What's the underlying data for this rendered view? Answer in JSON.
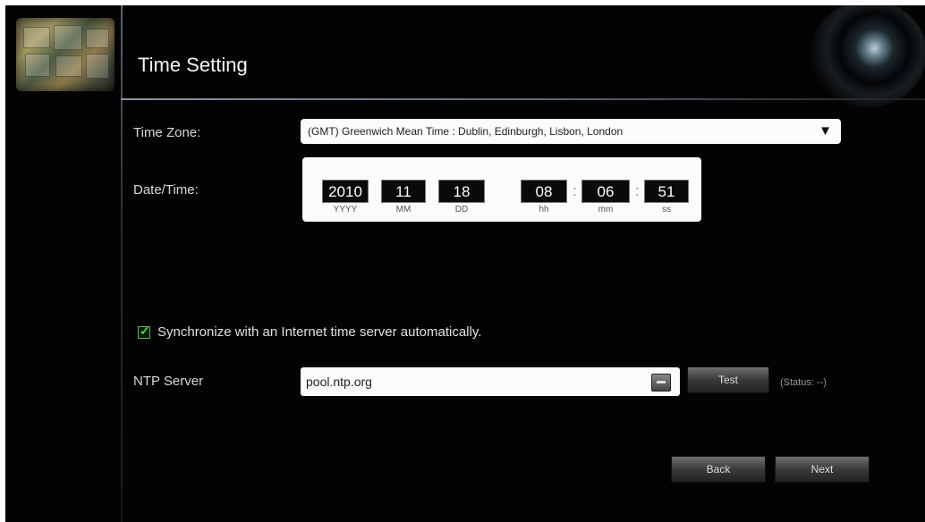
{
  "page": {
    "title": "Time Setting"
  },
  "time_zone": {
    "label": "Time Zone:",
    "value": "(GMT) Greenwich Mean Time : Dublin, Edinburgh, Lisbon, London"
  },
  "date_time": {
    "label": "Date/Time:",
    "year": "2010",
    "month": "11",
    "day": "18",
    "hour": "08",
    "minute": "06",
    "second": "51",
    "units": {
      "year": "YYYY",
      "month": "MM",
      "day": "DD",
      "hour": "hh",
      "minute": "mm",
      "second": "ss"
    },
    "separator": ":"
  },
  "sync": {
    "checked": true,
    "label": "Synchronize with an Internet time server automatically."
  },
  "ntp": {
    "label": "NTP Server",
    "value": "pool.ntp.org",
    "test_label": "Test",
    "status": "(Status: --)"
  },
  "footer": {
    "back_label": "Back",
    "next_label": "Next"
  },
  "icons": {
    "checkbox": "check-icon",
    "dropdown": "triangle-down-icon",
    "ntp_dropdown": "dropdown-icon"
  }
}
